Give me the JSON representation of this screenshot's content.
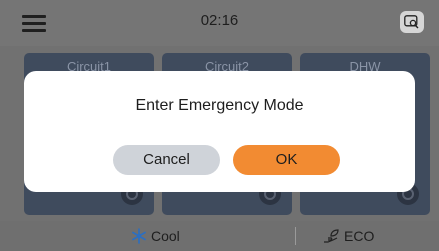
{
  "header": {
    "time": "02:16",
    "menu_icon": "hamburger-menu-icon",
    "search_icon": "search-icon"
  },
  "tiles": [
    {
      "label": "Circuit1"
    },
    {
      "label": "Circuit2"
    },
    {
      "label": "DHW"
    }
  ],
  "footer": {
    "cool_label": "Cool",
    "eco_label": "ECO",
    "cool_icon": "snowflake-icon",
    "eco_icon": "hand-leaf-icon"
  },
  "dialog": {
    "message": "Enter Emergency Mode",
    "cancel_label": "Cancel",
    "ok_label": "OK"
  },
  "colors": {
    "ok_accent": "#f28b32",
    "cool_icon": "#2b6fc2"
  }
}
